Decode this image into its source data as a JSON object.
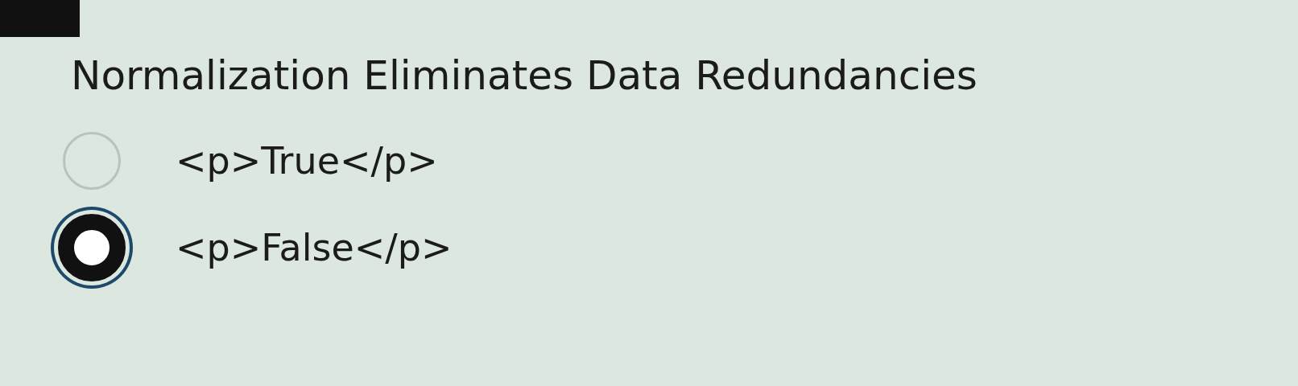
{
  "question": {
    "text": "Normalization Eliminates Data Redundancies"
  },
  "options": [
    {
      "label": "<p>True</p>",
      "selected": false
    },
    {
      "label": "<p>False</p>",
      "selected": true
    }
  ]
}
